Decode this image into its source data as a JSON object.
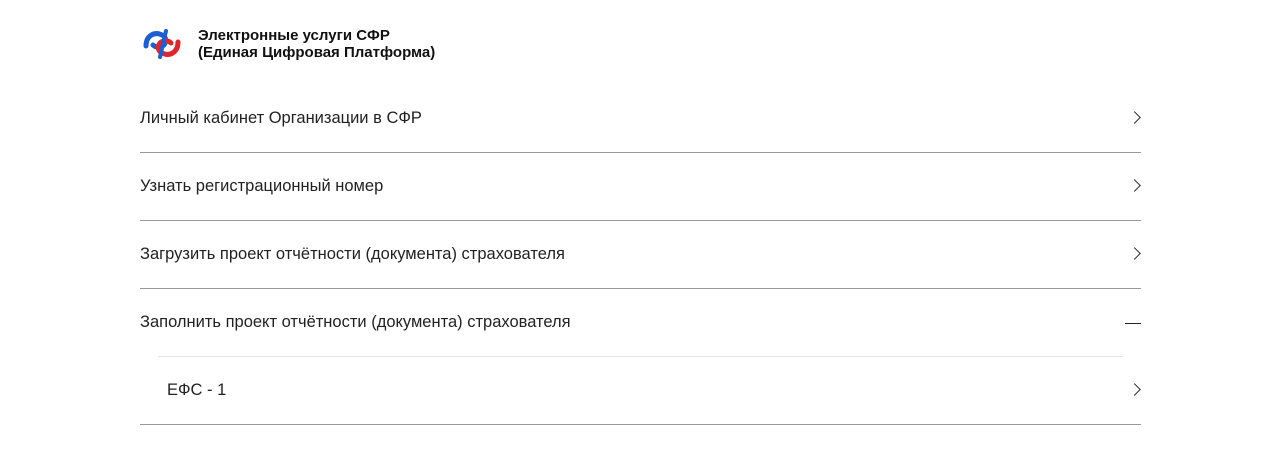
{
  "brand": {
    "line1": "Электронные услуги СФР",
    "line2": "(Единая Цифровая Платформа)",
    "logo_icon": "sfr-logo-icon",
    "colors": {
      "blue": "#1d5fd1",
      "red": "#e0262b"
    }
  },
  "menu": {
    "items": [
      {
        "label": "Личный кабинет Организации в СФР",
        "icon": "chevron-right-icon"
      },
      {
        "label": "Узнать регистрационный номер",
        "icon": "chevron-right-icon"
      },
      {
        "label": "Загрузить проект отчётности (документа) страхователя",
        "icon": "chevron-right-icon"
      },
      {
        "label": "Заполнить проект отчётности (документа) страхователя",
        "icon": "collapse-minus-icon",
        "expanded": true,
        "subitems": [
          {
            "label": "ЕФС - 1",
            "icon": "chevron-right-icon"
          }
        ]
      }
    ]
  }
}
